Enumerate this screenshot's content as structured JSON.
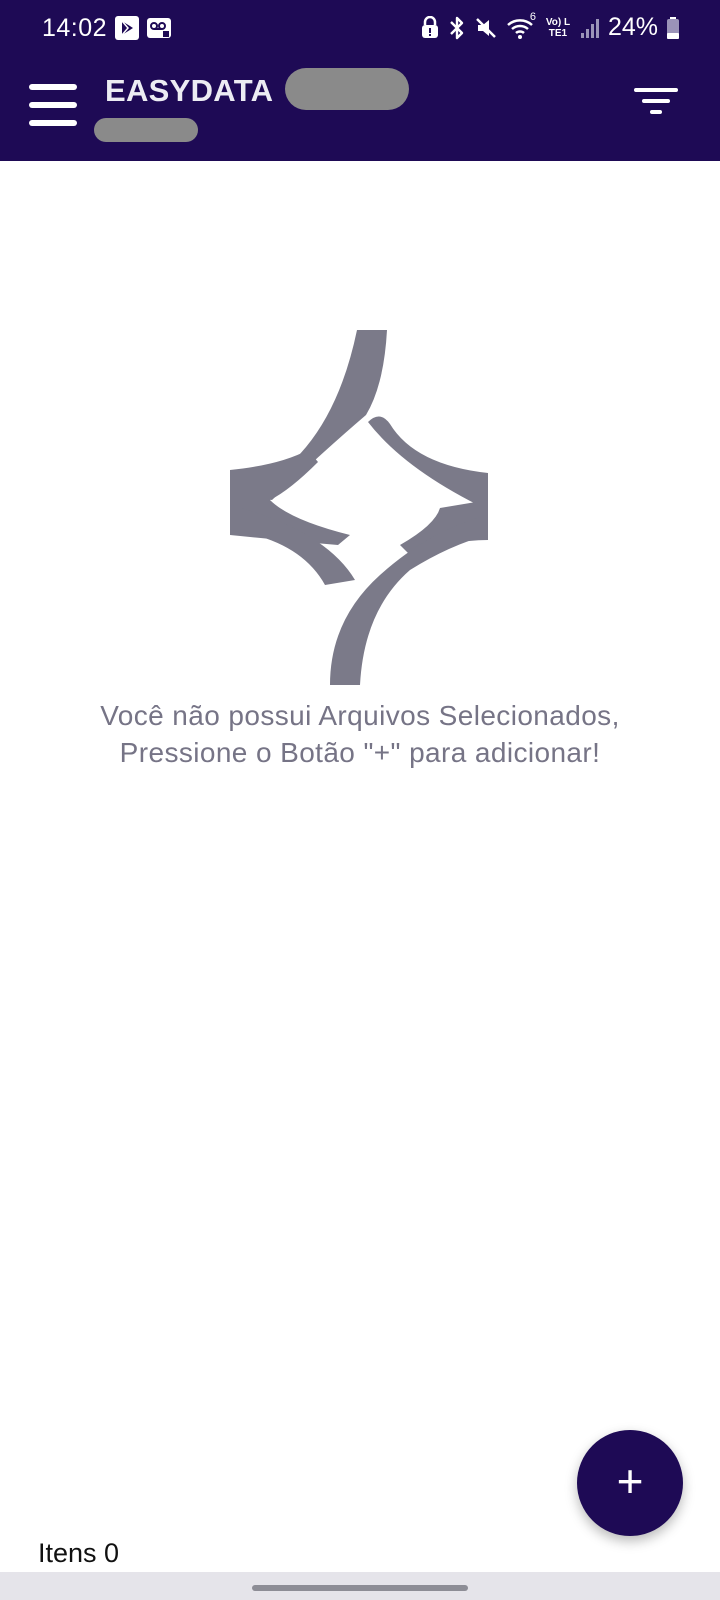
{
  "status_bar": {
    "time": "14:02",
    "battery": "24%",
    "left_icons": [
      "play-store-icon",
      "voicemail-icon"
    ],
    "right_icons": [
      "lock-alert-icon",
      "bluetooth-icon",
      "mute-icon",
      "wifi-icon",
      "volte-lte-icon",
      "signal-icon",
      "battery-icon"
    ],
    "network_label": "Vo) LTE1",
    "wifi_label": "6"
  },
  "app_bar": {
    "title": "EASYDATA",
    "menu_icon": "hamburger-menu-icon",
    "filter_icon": "filter-icon"
  },
  "empty_state": {
    "logo": "easydata-logo",
    "line1": "Você não possui Arquivos Selecionados,",
    "line2": "Pressione o Botão \"+\" para adicionar!"
  },
  "footer": {
    "items_text": "Itens 0"
  },
  "fab": {
    "label": "+"
  },
  "colors": {
    "primary": "#1e0a55",
    "logo_gray": "#7b7a89",
    "message_gray": "#767486",
    "background": "#ffffff",
    "nav_background": "#e5e4ea"
  }
}
